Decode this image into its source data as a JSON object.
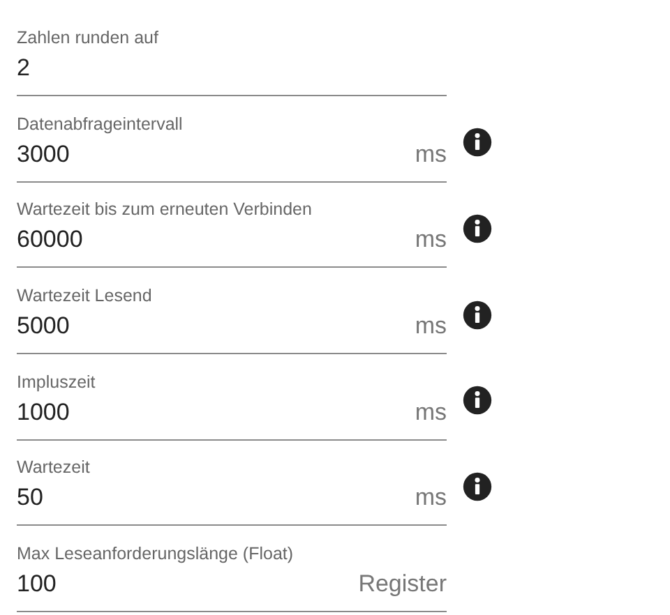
{
  "fields": [
    {
      "label": "Zahlen runden auf",
      "value": "2",
      "info": false
    },
    {
      "label": "Datenabfrageintervall",
      "value": "3000",
      "unit": "ms",
      "info": true
    },
    {
      "label": "Wartezeit bis zum erneuten Verbinden",
      "value": "60000",
      "unit": "ms",
      "info": true
    },
    {
      "label": "Wartezeit Lesend",
      "value": "5000",
      "unit": "ms",
      "info": true
    },
    {
      "label": "Impluszeit",
      "value": "1000",
      "unit": "ms",
      "info": true
    },
    {
      "label": "Wartezeit",
      "value": "50",
      "unit": "ms",
      "info": true
    },
    {
      "label": "Max Leseanforderungslänge (Float)",
      "value": "100",
      "unit": "Register",
      "info": false
    }
  ]
}
